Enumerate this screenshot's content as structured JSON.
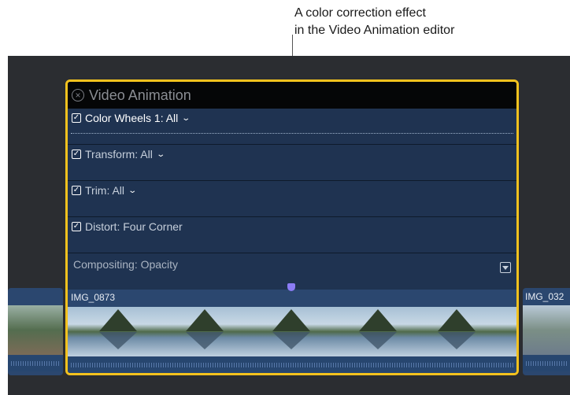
{
  "callout": {
    "line1": "A color correction effect",
    "line2": "in the Video Animation editor"
  },
  "editor": {
    "title": "Video Animation",
    "close_icon": "close-circle-icon",
    "rows": [
      {
        "label": "Color Wheels 1: All",
        "checked": true,
        "has_menu": true
      },
      {
        "label": "Transform: All",
        "checked": true,
        "has_menu": true
      },
      {
        "label": "Trim: All",
        "checked": true,
        "has_menu": true
      },
      {
        "label": "Distort: Four Corner",
        "checked": true,
        "has_menu": false
      }
    ],
    "compositing": {
      "label": "Compositing: Opacity"
    }
  },
  "clips": {
    "main": {
      "name": "IMG_0873"
    },
    "right": {
      "name": "IMG_032"
    }
  },
  "colors": {
    "selection_border": "#f3c21e",
    "editor_bg": "#1f3351",
    "playhead": "#8b7cf5"
  }
}
